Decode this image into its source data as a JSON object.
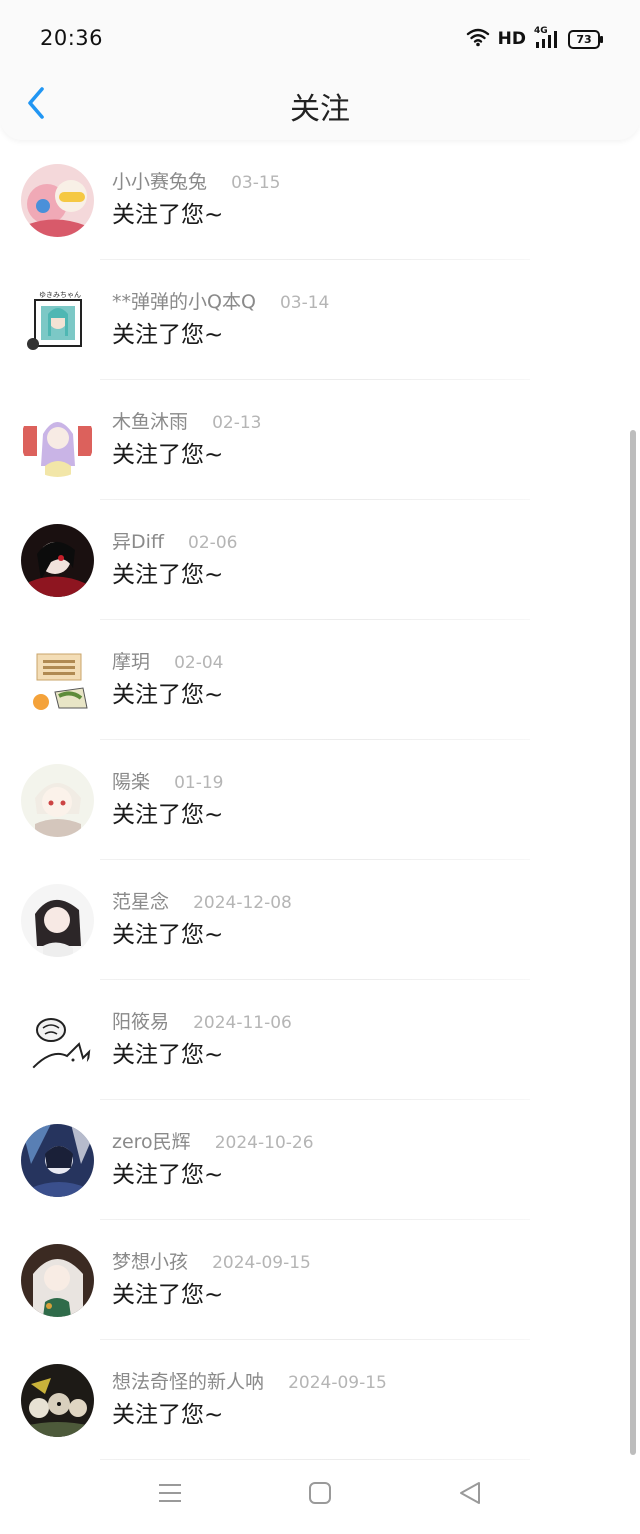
{
  "status_bar": {
    "time": "20:36",
    "network": "HD",
    "signal": "4G",
    "battery": "73"
  },
  "header": {
    "title": "关注",
    "back_icon": "chevron-left-icon"
  },
  "accent_color": "#2196F3",
  "items": [
    {
      "name": "小小赛兔兔",
      "date": "03-15",
      "message": "关注了您~"
    },
    {
      "name": "**弹弹的小Q本Q",
      "date": "03-14",
      "message": "关注了您~"
    },
    {
      "name": "木鱼沐雨",
      "date": "02-13",
      "message": "关注了您~"
    },
    {
      "name": "异Diff",
      "date": "02-06",
      "message": "关注了您~"
    },
    {
      "name": "摩玥",
      "date": "02-04",
      "message": "关注了您~"
    },
    {
      "name": "陽楽",
      "date": "01-19",
      "message": "关注了您~"
    },
    {
      "name": "范星念",
      "date": "2024-12-08",
      "message": "关注了您~"
    },
    {
      "name": "阳筱易",
      "date": "2024-11-06",
      "message": "关注了您~"
    },
    {
      "name": "zero民辉",
      "date": "2024-10-26",
      "message": "关注了您~"
    },
    {
      "name": "梦想小孩",
      "date": "2024-09-15",
      "message": "关注了您~"
    },
    {
      "name": "想法奇怪的新人呐",
      "date": "2024-09-15",
      "message": "关注了您~"
    }
  ],
  "nav_bar": {
    "icons": [
      "menu-icon",
      "home-square-icon",
      "back-triangle-icon"
    ]
  }
}
